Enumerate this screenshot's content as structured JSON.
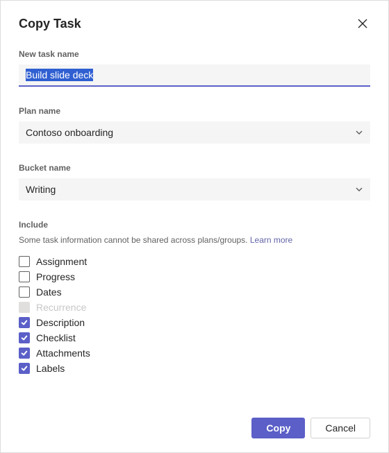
{
  "dialog": {
    "title": "Copy Task"
  },
  "taskName": {
    "label": "New task name",
    "value": "Build slide deck"
  },
  "planName": {
    "label": "Plan name",
    "value": "Contoso onboarding"
  },
  "bucketName": {
    "label": "Bucket name",
    "value": "Writing"
  },
  "include": {
    "label": "Include",
    "hint": "Some task information cannot be shared across plans/groups. ",
    "learnMore": "Learn more",
    "items": [
      {
        "label": "Assignment",
        "checked": false,
        "disabled": false
      },
      {
        "label": "Progress",
        "checked": false,
        "disabled": false
      },
      {
        "label": "Dates",
        "checked": false,
        "disabled": false
      },
      {
        "label": "Recurrence",
        "checked": false,
        "disabled": true
      },
      {
        "label": "Description",
        "checked": true,
        "disabled": false
      },
      {
        "label": "Checklist",
        "checked": true,
        "disabled": false
      },
      {
        "label": "Attachments",
        "checked": true,
        "disabled": false
      },
      {
        "label": "Labels",
        "checked": true,
        "disabled": false
      }
    ]
  },
  "footer": {
    "primary": "Copy",
    "secondary": "Cancel"
  }
}
